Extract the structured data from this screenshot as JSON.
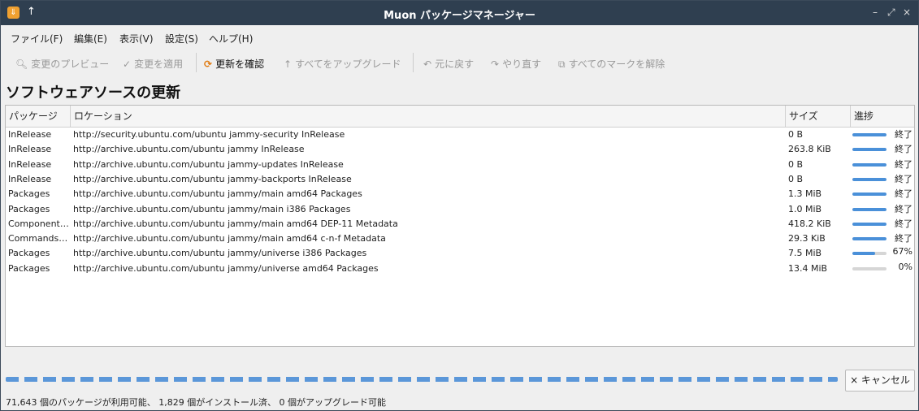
{
  "window": {
    "title": "Muon パッケージマネージャー",
    "app_icon": "⇓",
    "pin_icon": "↑",
    "min_icon": "–",
    "max_icon": "⤢",
    "close_icon": "×"
  },
  "menu": [
    "ファイル(F)",
    "編集(E)",
    "表示(V)",
    "設定(S)",
    "ヘルプ(H)"
  ],
  "toolbar": {
    "preview": {
      "icon": "🔍︎",
      "label": "変更のプレビュー"
    },
    "apply": {
      "icon": "✓",
      "label": "変更を適用"
    },
    "check": {
      "icon": "⟳",
      "label": "更新を確認"
    },
    "upgrade_all": {
      "icon": "↑",
      "label": "すべてをアップグレード"
    },
    "undo": {
      "icon": "↶",
      "label": "元に戻す"
    },
    "redo": {
      "icon": "↷",
      "label": "やり直す"
    },
    "unmark_all": {
      "icon": "⧉",
      "label": "すべてのマークを解除"
    }
  },
  "heading": "ソフトウェアソースの更新",
  "table": {
    "headers": {
      "package": "パッケージ",
      "location": "ロケーション",
      "size": "サイズ",
      "progress": "進捗"
    },
    "rows": [
      {
        "package": "InRelease",
        "location": "http://security.ubuntu.com/ubuntu jammy-security InRelease",
        "size": "0 B",
        "progress": 100,
        "status": "終了"
      },
      {
        "package": "InRelease",
        "location": "http://archive.ubuntu.com/ubuntu jammy InRelease",
        "size": "263.8 KiB",
        "progress": 100,
        "status": "終了"
      },
      {
        "package": "InRelease",
        "location": "http://archive.ubuntu.com/ubuntu jammy-updates InRelease",
        "size": "0 B",
        "progress": 100,
        "status": "終了"
      },
      {
        "package": "InRelease",
        "location": "http://archive.ubuntu.com/ubuntu jammy-backports InRelease",
        "size": "0 B",
        "progress": 100,
        "status": "終了"
      },
      {
        "package": "Packages",
        "location": "http://archive.ubuntu.com/ubuntu jammy/main amd64 Packages",
        "size": "1.3 MiB",
        "progress": 100,
        "status": "終了"
      },
      {
        "package": "Packages",
        "location": "http://archive.ubuntu.com/ubuntu jammy/main i386 Packages",
        "size": "1.0 MiB",
        "progress": 100,
        "status": "終了"
      },
      {
        "package": "Component…",
        "location": "http://archive.ubuntu.com/ubuntu jammy/main amd64 DEP-11 Metadata",
        "size": "418.2 KiB",
        "progress": 100,
        "status": "終了"
      },
      {
        "package": "Commands-…",
        "location": "http://archive.ubuntu.com/ubuntu jammy/main amd64 c-n-f Metadata",
        "size": "29.3 KiB",
        "progress": 100,
        "status": "終了"
      },
      {
        "package": "Packages",
        "location": "http://archive.ubuntu.com/ubuntu jammy/universe i386 Packages",
        "size": "7.5 MiB",
        "progress": 67,
        "status": "67%"
      },
      {
        "package": "Packages",
        "location": "http://archive.ubuntu.com/ubuntu jammy/universe amd64 Packages",
        "size": "13.4 MiB",
        "progress": 0,
        "status": "0%"
      }
    ]
  },
  "cancel_button": "× キャンセル",
  "status_bar": "71,643 個のパッケージが利用可能、 1,829 個がインストール済、 0 個がアップグレード可能"
}
